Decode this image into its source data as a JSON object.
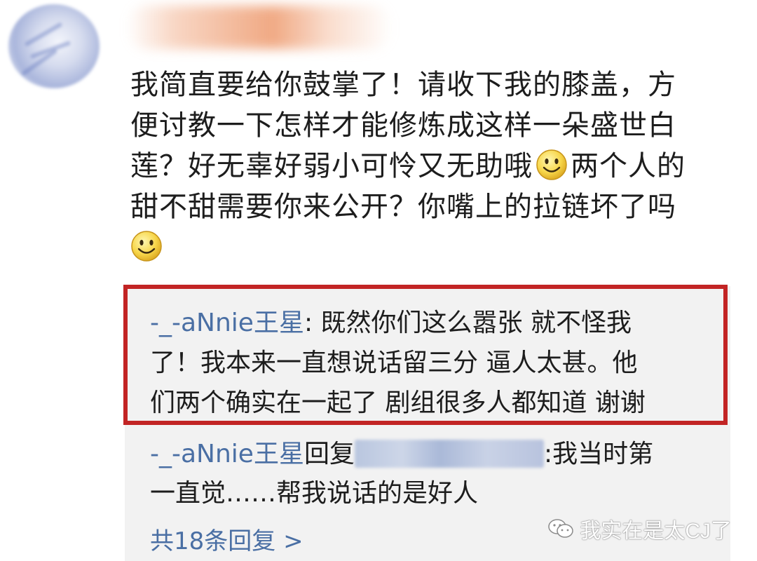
{
  "comment": {
    "line1": "我简直要给你鼓掌了！请收下我的膝盖，方",
    "line2": "便讨教一下怎样才能修炼成这样一朵盛世白",
    "line3a": "莲？好无辜好弱小可怜又无助哦",
    "line3b": "两个人的",
    "line4": "甜不甜需要你来公开？你嘴上的拉链坏了吗"
  },
  "highlighted_reply": {
    "username": "-_-aNnie王星",
    "line1": ": 既然你们这么嚣张 就不怪我",
    "line2": "了！我本来一直想说话留三分 逼人太甚。他",
    "line3": "们两个确实在一起了 剧组很多人都知道 谢谢"
  },
  "second_reply": {
    "username": "-_-aNnie王星",
    "reply_word": "回复",
    "masked_suffix": ":",
    "line1_end": "我当时第",
    "line2": "一直觉……帮我说话的是好人"
  },
  "more_replies_label": "共18条回复 >",
  "watermark": {
    "text": "我实在是太CJ了",
    "icon": "wechat-icon"
  },
  "colors": {
    "link_blue": "#4a6fa4",
    "highlight_border": "#c22424",
    "reply_bg": "#f2f2f2"
  }
}
